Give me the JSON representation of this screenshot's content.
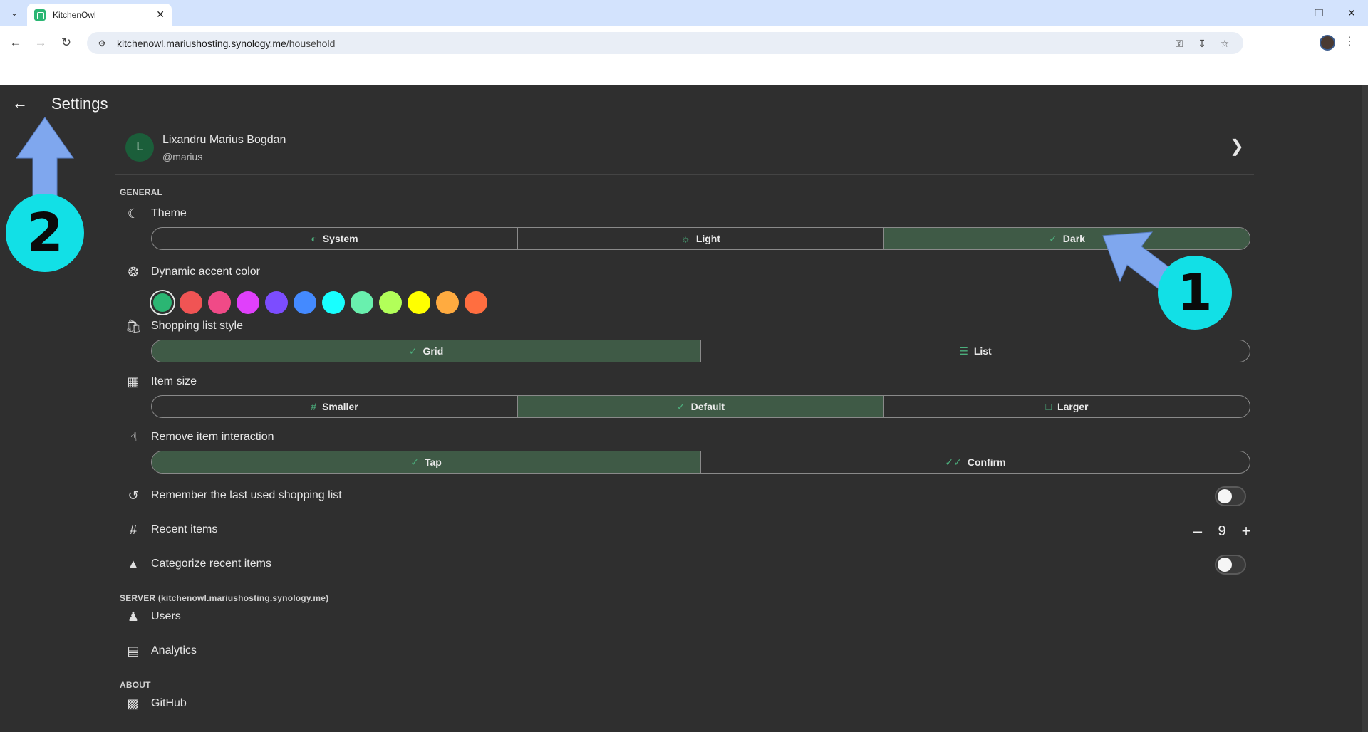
{
  "browser": {
    "tab_title": "KitchenOwl",
    "url_host": "kitchenowl.mariushosting.synology.me",
    "url_path": "/household"
  },
  "header": {
    "title": "Settings"
  },
  "profile": {
    "initial": "L",
    "name": "Lixandru Marius Bogdan",
    "username": "@marius"
  },
  "sections": {
    "general": "GENERAL",
    "server": "SERVER (kitchenowl.mariushosting.synology.me)",
    "about": "ABOUT"
  },
  "theme": {
    "label": "Theme",
    "options": [
      "System",
      "Light",
      "Dark"
    ],
    "selected": "Dark"
  },
  "accent": {
    "label": "Dynamic accent color",
    "colors": [
      "#2bb673",
      "#f05454",
      "#f04a87",
      "#e040fb",
      "#7c4dff",
      "#448aff",
      "#18ffff",
      "#69f0ae",
      "#b2ff59",
      "#ffff00",
      "#ffab40",
      "#ff6e40"
    ],
    "selected": "#2bb673"
  },
  "shopping_list_style": {
    "label": "Shopping list style",
    "options": [
      "Grid",
      "List"
    ],
    "selected": "Grid"
  },
  "item_size": {
    "label": "Item size",
    "options": [
      "Smaller",
      "Default",
      "Larger"
    ],
    "selected": "Default"
  },
  "remove_interaction": {
    "label": "Remove item interaction",
    "options": [
      "Tap",
      "Confirm"
    ],
    "selected": "Tap"
  },
  "remember_last_list": {
    "label": "Remember the last used shopping list",
    "enabled": false
  },
  "recent_items": {
    "label": "Recent items",
    "value": "9",
    "minus": "–",
    "plus": "+"
  },
  "categorize_recent": {
    "label": "Categorize recent items",
    "enabled": false
  },
  "server_items": {
    "users": "Users",
    "analytics": "Analytics"
  },
  "about_items": {
    "github": "GitHub"
  },
  "annotations": {
    "step1": "1",
    "step2": "2",
    "color": "#12e0e6",
    "arrow_color": "#7fa7ee"
  }
}
